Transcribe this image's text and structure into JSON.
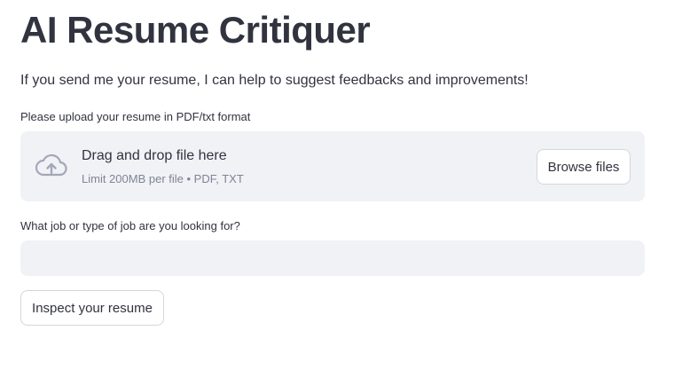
{
  "header": {
    "title": "AI Resume Critiquer",
    "intro": "If you send me your resume, I can help to suggest feedbacks and improvements!"
  },
  "upload": {
    "label": "Please upload your resume in PDF/txt format",
    "drop_title": "Drag and drop file here",
    "limit_text": "Limit 200MB per file • PDF, TXT",
    "browse_label": "Browse files",
    "icon": "cloud-upload-icon"
  },
  "job": {
    "label": "What job or type of job are you looking for?",
    "value": "",
    "placeholder": ""
  },
  "actions": {
    "inspect_label": "Inspect your resume"
  },
  "colors": {
    "text": "#31333f",
    "muted": "#808495",
    "surface": "#f0f2f6",
    "border": "#d5d6db",
    "icon": "#a3a8b8"
  }
}
